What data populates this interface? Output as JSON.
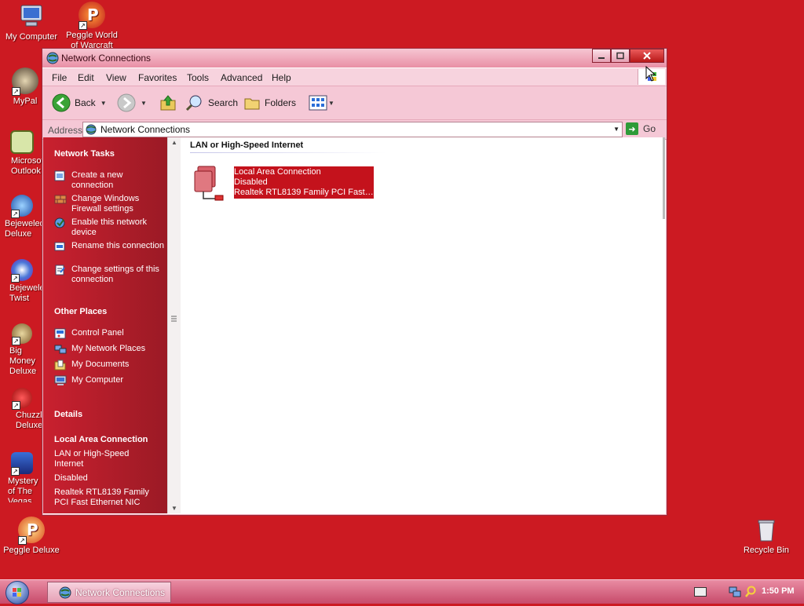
{
  "desktop": {
    "icons": [
      {
        "label": "My Computer",
        "icon": "computer-icon"
      },
      {
        "label": "Peggle World of Warcraft",
        "icon": "peggle-icon"
      },
      {
        "label": "MyPal",
        "icon": "raccoon-icon"
      },
      {
        "label": "Microsoft Outlook",
        "icon": "outlook-icon"
      },
      {
        "label": "Bejeweled Deluxe",
        "icon": "bejeweled-icon"
      },
      {
        "label": "Bejeweled Twist",
        "icon": "bejeweled-twist-icon"
      },
      {
        "label": "Big Money Deluxe",
        "icon": "money-bag-icon"
      },
      {
        "label": "Chuzzle Deluxe",
        "icon": "chuzzle-icon"
      },
      {
        "label": "Mystery of The Vegas",
        "icon": "mystery-icon"
      },
      {
        "label": "Peggle Deluxe",
        "icon": "peggle-deluxe-icon"
      },
      {
        "label": "Recycle Bin",
        "icon": "recycle-bin-icon"
      }
    ]
  },
  "window": {
    "title": "Network Connections",
    "menu": [
      "File",
      "Edit",
      "View",
      "Favorites",
      "Tools",
      "Advanced",
      "Help"
    ],
    "toolbar": {
      "back": "Back",
      "search": "Search",
      "folders": "Folders"
    },
    "address": {
      "label": "Address",
      "value": "Network Connections",
      "go": "Go"
    }
  },
  "taskpane": {
    "network_tasks": {
      "title": "Network Tasks",
      "items": [
        "Create a new connection",
        "Change Windows Firewall settings",
        "Enable this network device",
        "Rename this connection",
        "Change settings of this connection"
      ]
    },
    "other_places": {
      "title": "Other Places",
      "items": [
        "Control Panel",
        "My Network Places",
        "My Documents",
        "My Computer"
      ]
    },
    "details": {
      "title": "Details",
      "name": "Local Area Connection",
      "type": "LAN or High-Speed Internet",
      "status": "Disabled",
      "device": "Realtek RTL8139 Family PCI Fast Ethernet NIC"
    }
  },
  "content": {
    "group_header": "LAN or High-Speed Internet",
    "connection": {
      "name": "Local Area Connection",
      "status": "Disabled",
      "device": "Realtek RTL8139 Family PCI Fast E..."
    }
  },
  "taskbar": {
    "task_button": "Network Connections",
    "clock": "1:50 PM"
  },
  "colors": {
    "desktop": "#cc1a22",
    "taskpane": "#b01c28",
    "selection": "#c4121c"
  }
}
